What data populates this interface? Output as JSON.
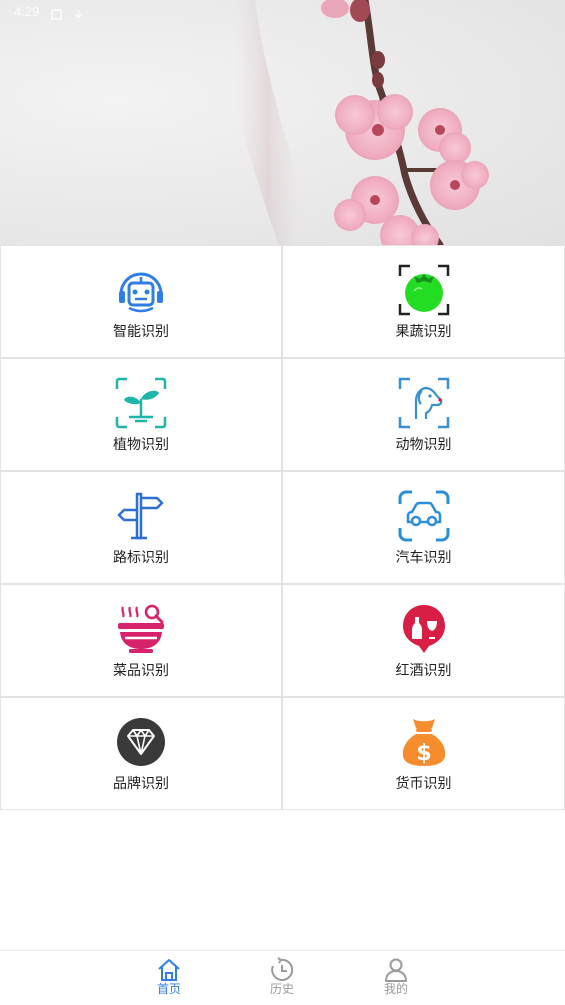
{
  "status_bar": {
    "time": "4:29"
  },
  "grid_items": [
    {
      "label": "智能识别",
      "icon": "robot-icon"
    },
    {
      "label": "果蔬识别",
      "icon": "tomato-icon"
    },
    {
      "label": "植物识别",
      "icon": "plant-icon"
    },
    {
      "label": "动物识别",
      "icon": "dog-icon"
    },
    {
      "label": "路标识别",
      "icon": "signpost-icon"
    },
    {
      "label": "汽车识别",
      "icon": "car-icon"
    },
    {
      "label": "菜品识别",
      "icon": "dish-icon"
    },
    {
      "label": "红酒识别",
      "icon": "wine-icon"
    },
    {
      "label": "品牌识别",
      "icon": "diamond-icon"
    },
    {
      "label": "货币识别",
      "icon": "money-bag-icon"
    }
  ],
  "tabs": [
    {
      "label": "首页",
      "icon": "home-icon",
      "active": true
    },
    {
      "label": "历史",
      "icon": "history-icon",
      "active": false
    },
    {
      "label": "我的",
      "icon": "profile-icon",
      "active": false
    }
  ],
  "colors": {
    "active_tab": "#2f7ee6",
    "inactive_tab": "#9a9a9a",
    "robot": "#2f7ee6",
    "tomato": "#22dd22",
    "plant": "#1fb5a8",
    "dog": "#3a8fd0",
    "signpost": "#2e6fd6",
    "car": "#2a8fd8",
    "dish": "#d6236c",
    "wine": "#d81e45",
    "diamond": "#3a3a3a",
    "money_bag": "#f58d2e"
  }
}
